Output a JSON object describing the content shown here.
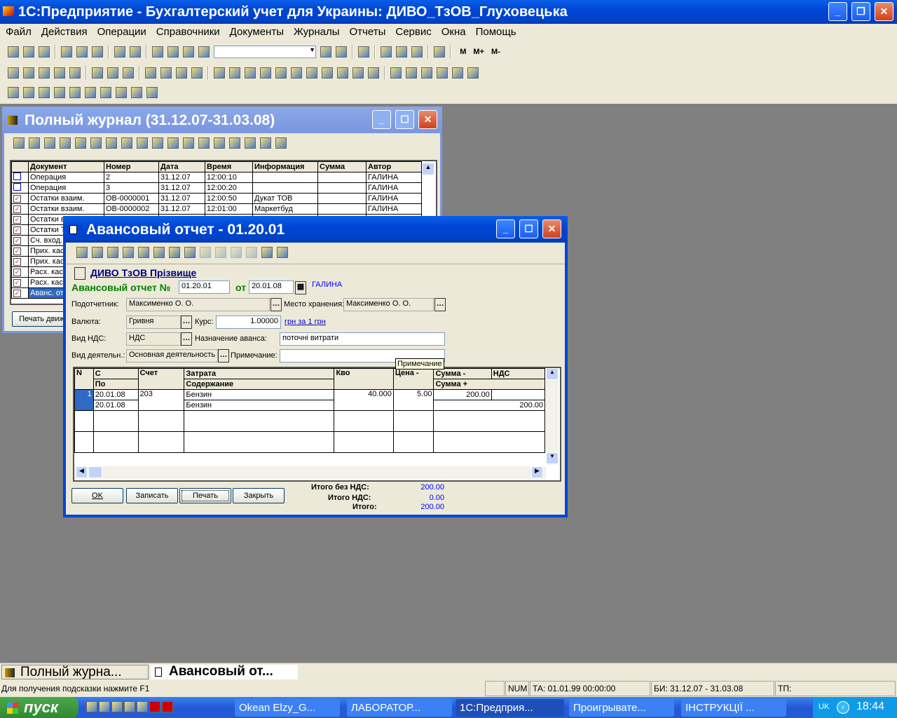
{
  "app": {
    "title": "1С:Предприятие - Бухгалтерский учет для Украины: ДИВО_ТзОВ_Глуховецька",
    "menu": [
      "Файл",
      "Действия",
      "Операции",
      "Справочники",
      "Документы",
      "Журналы",
      "Отчеты",
      "Сервис",
      "Окна",
      "Помощь"
    ],
    "toolbar_memory": [
      "M",
      "M+",
      "M-"
    ]
  },
  "journal": {
    "title": "Полный журнал (31.12.07-31.03.08)",
    "columns": [
      "Документ",
      "Номер",
      "Дата",
      "Время",
      "Информация",
      "Сумма",
      "Автор"
    ],
    "rows": [
      {
        "icon": "operation-icon",
        "doc": "Операция",
        "num": "2",
        "date": "31.12.07",
        "time": "12:00:10",
        "info": "",
        "sum": "",
        "author": "ГАЛИНА"
      },
      {
        "icon": "operation-icon",
        "doc": "Операция",
        "num": "3",
        "date": "31.12.07",
        "time": "12:00:20",
        "info": "",
        "sum": "",
        "author": "ГАЛИНА"
      },
      {
        "icon": "document-check-icon",
        "doc": "Остатки взаим.",
        "num": "ОВ-0000001",
        "date": "31.12.07",
        "time": "12:00:50",
        "info": "Дукат ТОВ",
        "sum": "",
        "author": "ГАЛИНА"
      },
      {
        "icon": "document-check-icon",
        "doc": "Остатки взаим.",
        "num": "ОВ-0000002",
        "date": "31.12.07",
        "time": "12:01:00",
        "info": "Маркетбуд",
        "sum": "",
        "author": "ГАЛИНА"
      },
      {
        "icon": "document-check-icon",
        "doc": "Остатки в"
      },
      {
        "icon": "document-check-icon",
        "doc": "Остатки Т"
      },
      {
        "icon": "document-check-icon",
        "doc": "Сч. вход."
      },
      {
        "icon": "document-check-icon",
        "doc": "Прих. кас"
      },
      {
        "icon": "document-check-icon",
        "doc": "Прих. кас"
      },
      {
        "icon": "document-check-icon",
        "doc": "Расх. кас"
      },
      {
        "icon": "document-check-icon",
        "doc": "Расх. кас"
      },
      {
        "icon": "document-check-icon",
        "doc": "Аванс. от"
      }
    ],
    "print_button": "Печать движ"
  },
  "avans": {
    "title": "Авансовый отчет - 01.20.01",
    "firm": "ДИВО  ТзОВ  Прізвище",
    "doc_label": "Авансовый отчет №",
    "number": "01.20.01",
    "from_label": "от",
    "date": "20.01.08",
    "author": "ГАЛИНА",
    "podotchetnik_label": "Подотчетник:",
    "podotchetnik": "Максименко О. О.",
    "storage_label": "Место хранения:",
    "storage": "Максименко О. О.",
    "currency_label": "Валюта:",
    "currency": "Гривня",
    "rate_label": "Курс:",
    "rate": "1.00000",
    "rate_link": "грн за 1 грн",
    "vat_label": "Вид НДС:",
    "vat": "НДС",
    "purpose_label": "Назначение аванса:",
    "purpose": "поточні витрати",
    "activity_label": "Вид деятельн.:",
    "activity": "Основная деятельность",
    "note_label": "Примечание:",
    "note": "",
    "tooltip": "Примечание",
    "grid_headers": {
      "n": "N",
      "c": "С",
      "po": "По",
      "account": "Счет",
      "cost": "Затрата",
      "content": "Содержание",
      "qty": "Кво",
      "price": "Цена -",
      "sum_minus": "Сумма -",
      "vat": "НДС",
      "sum_plus": "Сумма +"
    },
    "grid_rows": [
      {
        "n": "1",
        "c": "20.01.08",
        "po": "20.01.08",
        "account": "203",
        "cost": "Бензин",
        "content": "Бензин",
        "qty": "40.000",
        "price": "5.00",
        "sum_minus": "200.00",
        "vat": "",
        "sum_plus": "200.00"
      }
    ],
    "buttons": {
      "ok": "OK",
      "save": "Записать",
      "print": "Печать",
      "close": "Закрыть"
    },
    "totals": {
      "no_vat_label": "Итого без НДС:",
      "no_vat": "200.00",
      "vat_label": "Итого НДС:",
      "vat": "0.00",
      "total_label": "Итого:",
      "total": "200.00"
    }
  },
  "window_tabs": [
    "Полный журна...",
    "Авансовый от..."
  ],
  "status": {
    "hint": "Для получения подсказки нажмите F1",
    "num": "NUM",
    "ta": "ТА: 01.01.99  00:00:00",
    "bi": "БИ: 31.12.07 - 31.03.08",
    "tp": "ТП:"
  },
  "taskbar": {
    "start": "пуск",
    "items": [
      "Okean Elzy_G...",
      "ЛАБОРАТОР...",
      "1С:Предприя...",
      "Проигрывате...",
      "ІНСТРУКЦІЇ ..."
    ],
    "lang": "UK",
    "clock": "18:44"
  }
}
